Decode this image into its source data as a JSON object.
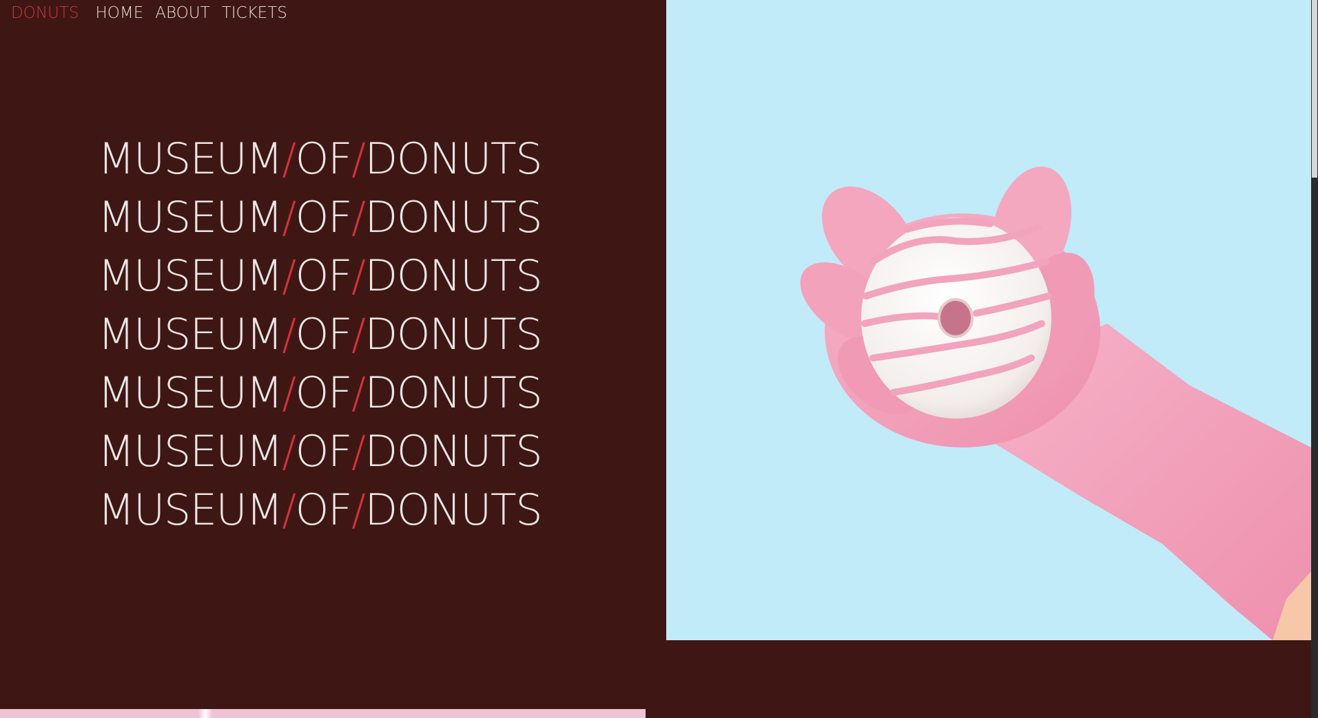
{
  "nav": {
    "brand": "DONUTS",
    "links": [
      "HOME",
      "ABOUT",
      "TICKETS"
    ]
  },
  "hero": {
    "lines": [
      {
        "w1": "MUSEUM",
        "s1": "/",
        "w2": "OF",
        "s2": "/",
        "w3": "DONUTS"
      },
      {
        "w1": "MUSEUM",
        "s1": "/",
        "w2": "OF",
        "s2": "/",
        "w3": "DONUTS"
      },
      {
        "w1": "MUSEUM",
        "s1": "/",
        "w2": "OF",
        "s2": "/",
        "w3": "DONUTS"
      },
      {
        "w1": "MUSEUM",
        "s1": "/",
        "w2": "OF",
        "s2": "/",
        "w3": "DONUTS"
      },
      {
        "w1": "MUSEUM",
        "s1": "/",
        "w2": "OF",
        "s2": "/",
        "w3": "DONUTS"
      },
      {
        "w1": "MUSEUM",
        "s1": "/",
        "w2": "OF",
        "s2": "/",
        "w3": "DONUTS"
      },
      {
        "w1": "MUSEUM",
        "s1": "/",
        "w2": "OF",
        "s2": "/",
        "w3": "DONUTS"
      }
    ]
  },
  "image": {
    "subject": "pink-gloved-hand-holding-glazed-donut"
  },
  "colors": {
    "background": "#3e1714",
    "accent": "#d3323a",
    "text": "#ece6e6",
    "image_bg": "#c1ebf8",
    "glove": "#f4a6bf"
  }
}
